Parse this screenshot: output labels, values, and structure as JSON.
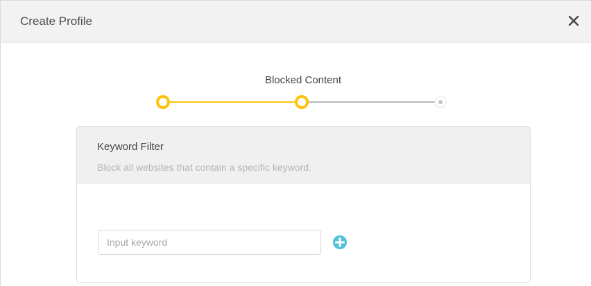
{
  "dialog": {
    "title": "Create Profile",
    "close_icon": "close-icon"
  },
  "stepper": {
    "current_step_label": "Blocked Content",
    "steps_total": 3,
    "completed_steps": 2,
    "active_color": "#ffc20e",
    "inactive_color": "#b8b8b8"
  },
  "keyword_filter": {
    "title": "Keyword Filter",
    "description": "Block all websites that contain a specific keyword.",
    "input": {
      "value": "",
      "placeholder": "Input keyword"
    },
    "add_icon": "plus-circle-icon",
    "add_color": "#4fc3d8"
  }
}
